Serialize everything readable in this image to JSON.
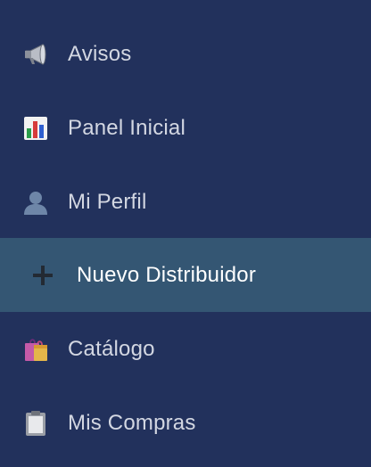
{
  "sidebar": {
    "items": [
      {
        "label": "Avisos",
        "icon": "megaphone-icon"
      },
      {
        "label": "Panel Inicial",
        "icon": "bar-chart-icon"
      },
      {
        "label": "Mi Perfil",
        "icon": "user-icon"
      },
      {
        "label": "Nuevo Distribuidor",
        "icon": "plus-icon",
        "active": true
      },
      {
        "label": "Catálogo",
        "icon": "shopping-bags-icon"
      },
      {
        "label": "Mis Compras",
        "icon": "clipboard-icon"
      }
    ]
  },
  "colors": {
    "background": "#22315c",
    "active_background": "#345673",
    "text": "#d3d7e2",
    "active_text": "#ffffff"
  }
}
